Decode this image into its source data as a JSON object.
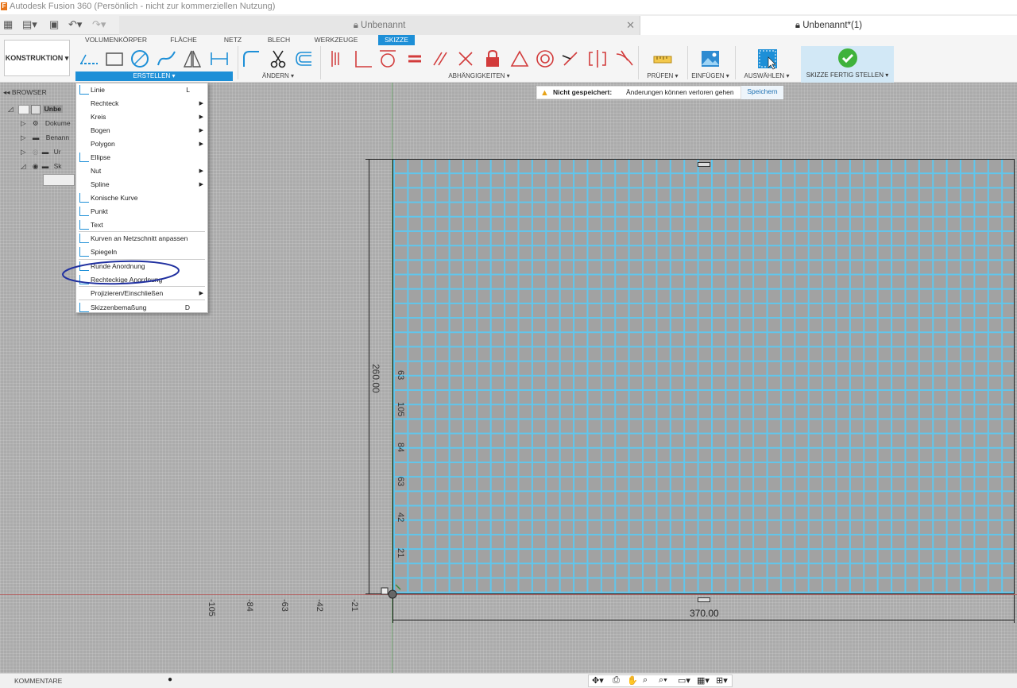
{
  "app_title": "Autodesk Fusion 360 (Persönlich - nicht zur kommerziellen Nutzung)",
  "doc_tabs": [
    "Unbenannt",
    "Unbenannt*(1)"
  ],
  "workspace": "KONSTRUKTION",
  "ribbon_tabs": [
    "VOLUMENKÖRPER",
    "FLÄCHE",
    "NETZ",
    "BLECH",
    "WERKZEUGE",
    "SKIZZE"
  ],
  "groups": {
    "erstellen": "ERSTELLEN",
    "aendern": "ÄNDERN",
    "abhaengigkeiten": "ABHÄNGIGKEITEN",
    "pruefen": "PRÜFEN",
    "einfuegen": "EINFÜGEN",
    "auswaehlen": "AUSWÄHLEN",
    "fertig": "SKIZZE FERTIG STELLEN"
  },
  "notice": {
    "title": "Nicht gespeichert:",
    "text": "Änderungen können verloren gehen",
    "button": "Speichern"
  },
  "browser": {
    "title": "BROWSER",
    "rows": [
      "Unbe",
      "Dokume",
      "Benann",
      "Ur",
      "Sk"
    ]
  },
  "menu": {
    "items": [
      {
        "label": "Linie",
        "shortcut": "L",
        "arrow": false,
        "icon": "line-icon"
      },
      {
        "label": "Rechteck",
        "shortcut": "",
        "arrow": true,
        "icon": ""
      },
      {
        "label": "Kreis",
        "shortcut": "",
        "arrow": true,
        "icon": ""
      },
      {
        "label": "Bogen",
        "shortcut": "",
        "arrow": true,
        "icon": ""
      },
      {
        "label": "Polygon",
        "shortcut": "",
        "arrow": true,
        "icon": ""
      },
      {
        "label": "Ellipse",
        "shortcut": "",
        "arrow": false,
        "icon": "ellipse-icon"
      },
      {
        "label": "Nut",
        "shortcut": "",
        "arrow": true,
        "icon": ""
      },
      {
        "label": "Spline",
        "shortcut": "",
        "arrow": true,
        "icon": ""
      },
      {
        "label": "Konische Kurve",
        "shortcut": "",
        "arrow": false,
        "icon": "conic-curve-icon"
      },
      {
        "label": "Punkt",
        "shortcut": "",
        "arrow": false,
        "icon": "point-icon"
      },
      {
        "label": "Text",
        "shortcut": "",
        "arrow": false,
        "icon": "text-icon"
      },
      {
        "label": "Kurven an Netzschnitt anpassen",
        "shortcut": "",
        "arrow": false,
        "icon": "mesh-section-icon"
      },
      {
        "label": "Spiegeln",
        "shortcut": "",
        "arrow": false,
        "icon": "mirror-icon"
      },
      {
        "label": "Runde Anordnung",
        "shortcut": "",
        "arrow": false,
        "icon": "circular-pattern-icon"
      },
      {
        "label": "Rechteckige Anordnung",
        "shortcut": "",
        "arrow": false,
        "icon": "rectangular-pattern-icon"
      },
      {
        "label": "Projizieren/Einschließen",
        "shortcut": "",
        "arrow": true,
        "icon": ""
      },
      {
        "label": "Skizzenbemaßung",
        "shortcut": "D",
        "arrow": false,
        "icon": "sketch-dimension-icon"
      }
    ]
  },
  "dimensions": {
    "height": "260.00",
    "width": "370.00"
  },
  "ticks_vertical": [
    "63",
    "105",
    "84",
    "63",
    "42",
    "21"
  ],
  "ticks_horizontal": [
    "-105",
    "-84",
    "-63",
    "-42",
    "-21"
  ],
  "footer": {
    "comments": "KOMMENTARE"
  },
  "colors": {
    "accent": "#1d8fd7",
    "grid_line": "#60c6ec",
    "annotation": "#2030a0"
  }
}
